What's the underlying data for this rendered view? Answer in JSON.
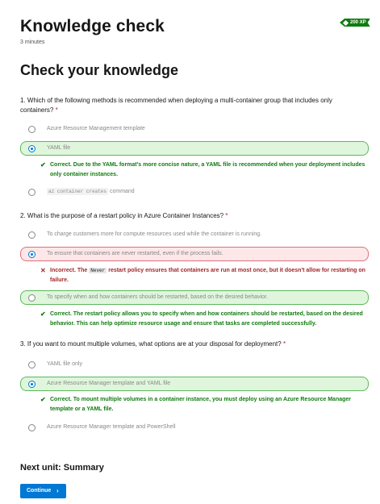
{
  "header": {
    "title": "Knowledge check",
    "duration": "3 minutes",
    "xp": "200 XP"
  },
  "section_title": "Check your knowledge",
  "questions": [
    {
      "text": "1. Which of the following methods is recommended when deploying a multi-container group that includes only containers?",
      "required_marker": "*",
      "options": [
        {
          "label": "Azure Resource Management template",
          "state": "unselected"
        },
        {
          "label": "YAML file",
          "state": "selected-correct"
        },
        {
          "code": "az container creates",
          "label": "command",
          "state": "unselected"
        }
      ],
      "feedback": [
        {
          "type": "correct",
          "text": "Correct. Due to the YAML format's more concise nature, a YAML file is recommended when your deployment includes only container instances."
        }
      ]
    },
    {
      "text": "2. What is the purpose of a restart policy in Azure Container Instances?",
      "required_marker": "*",
      "options": [
        {
          "label": "To charge customers more for compute resources used while the container is running.",
          "state": "unselected"
        },
        {
          "label": "To ensure that containers are never restarted, even if the process fails.",
          "state": "selected-incorrect"
        },
        {
          "label": "To specify when and how containers should be restarted, based on the desired behavior.",
          "state": "correct-answer"
        }
      ],
      "feedback": [
        {
          "type": "incorrect",
          "prefix": "Incorrect. The",
          "code": "Never",
          "suffix": "restart policy ensures that containers are run at most once, but it doesn't allow for restarting on failure."
        },
        {
          "type": "correct",
          "text": "Correct. The restart policy allows you to specify when and how containers should be restarted, based on the desired behavior. This can help optimize resource usage and ensure that tasks are completed successfully."
        }
      ]
    },
    {
      "text": "3. If you want to mount multiple volumes, what options are at your disposal for deployment?",
      "required_marker": "*",
      "options": [
        {
          "label": "YAML file only",
          "state": "unselected"
        },
        {
          "label": "Azure Resource Manager template and YAML file",
          "state": "selected-correct"
        },
        {
          "label": "Azure Resource Manager template and PowerShell",
          "state": "unselected"
        }
      ],
      "feedback": [
        {
          "type": "correct",
          "text": "Correct. To mount multiple volumes in a container instance, you must deploy using an Azure Resource Manager template or a YAML file."
        }
      ]
    }
  ],
  "footer": {
    "next_unit": "Next unit: Summary",
    "continue_label": "Continue",
    "continue_chevron": "›"
  },
  "icons": {
    "check": "✔",
    "cross": "✕"
  },
  "colors": {
    "accent": "#0078d4",
    "correct_bg": "#dff6dd",
    "correct_border": "#5cb85c",
    "incorrect_bg": "#fde7e9",
    "incorrect_border": "#e0707b",
    "correct_text": "#107c10",
    "incorrect_text": "#a4262c"
  }
}
